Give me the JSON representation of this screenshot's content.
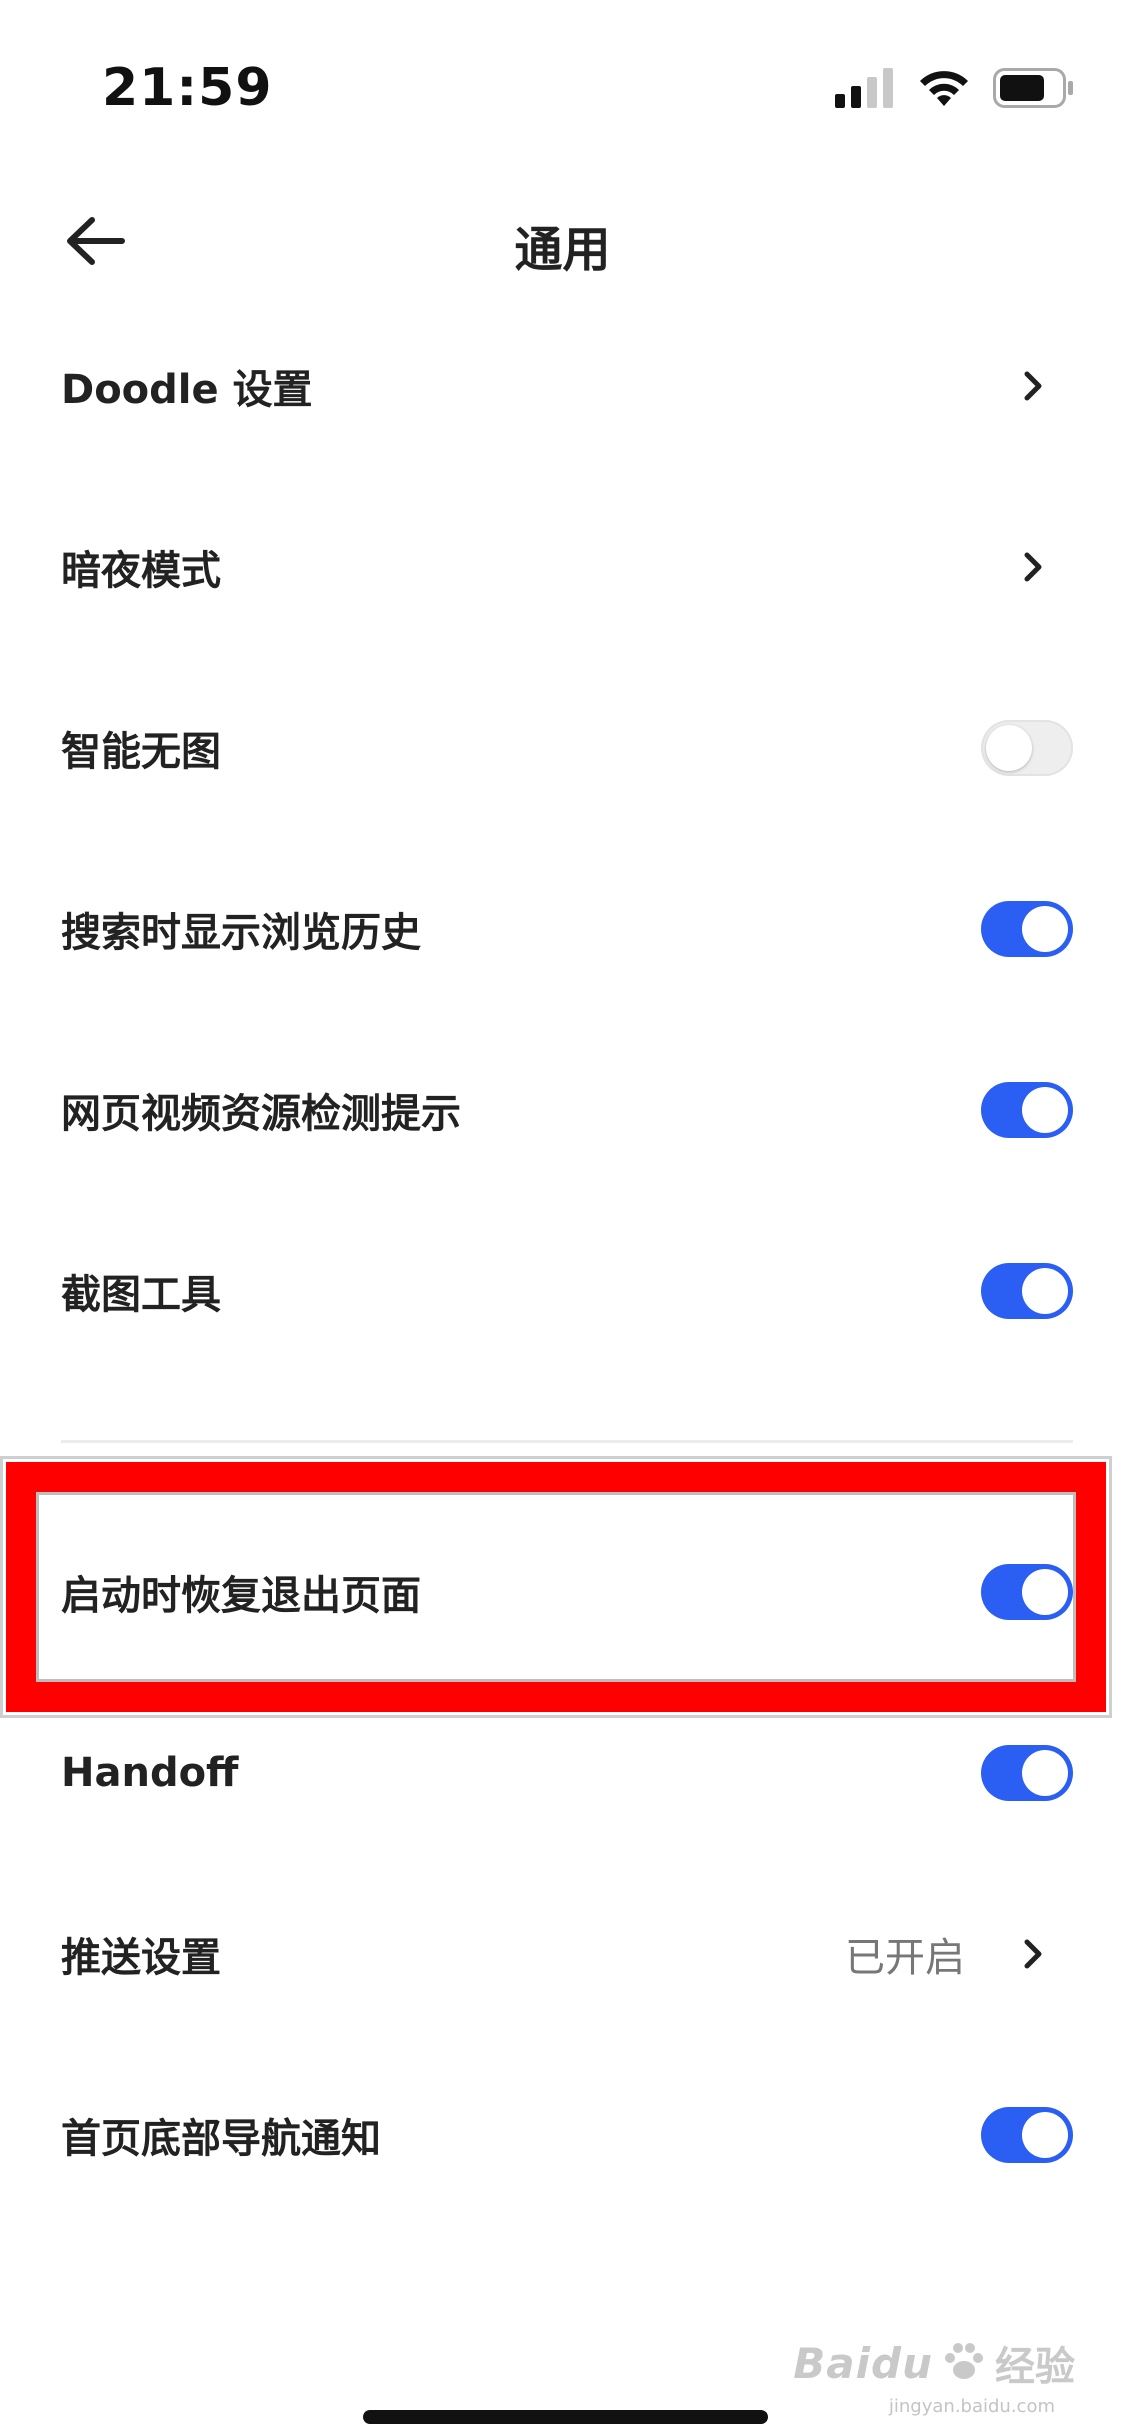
{
  "status_bar": {
    "time": "21:59",
    "signal_icon": "cellular-signal-icon",
    "wifi_icon": "wifi-icon",
    "battery_icon": "battery-icon"
  },
  "nav": {
    "title": "通用",
    "back_icon": "arrow-left-icon"
  },
  "settings": {
    "doodle": {
      "label": "Doodle 设置"
    },
    "dark_mode": {
      "label": "暗夜模式"
    },
    "smart_no_image": {
      "label": "智能无图",
      "enabled": false
    },
    "search_history": {
      "label": "搜索时显示浏览历史",
      "enabled": true
    },
    "video_detect": {
      "label": "网页视频资源检测提示",
      "enabled": true
    },
    "screenshot_tool": {
      "label": "截图工具",
      "enabled": true
    },
    "restore_pages": {
      "label": "启动时恢复退出页面",
      "enabled": true
    },
    "handoff": {
      "label": "Handoff",
      "enabled": true
    },
    "push": {
      "label": "推送设置",
      "value": "已开启"
    },
    "bottom_nav_notice": {
      "label": "首页底部导航通知",
      "enabled": true
    }
  },
  "colors": {
    "toggle_on": "#2b5ef2",
    "toggle_off": "#eeeeee",
    "highlight": "#ff0000"
  },
  "watermark": {
    "brand": "Baidu",
    "sub": "经验",
    "url": "jingyan.baidu.com"
  }
}
